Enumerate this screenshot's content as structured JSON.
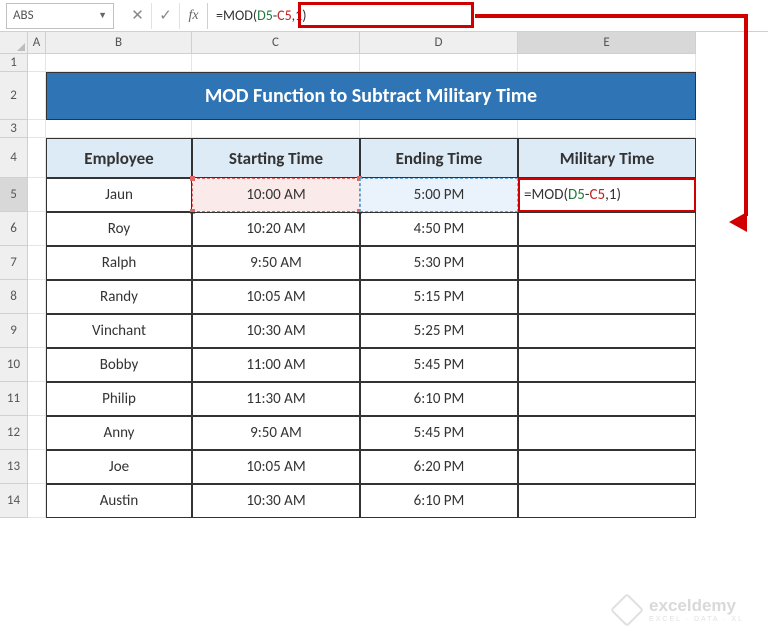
{
  "name_box": "ABS",
  "formula_bar": {
    "fx_label": "fx",
    "formula_raw": "=MOD(D5-C5,1)"
  },
  "columns": [
    "A",
    "B",
    "C",
    "D",
    "E"
  ],
  "row_numbers": [
    "1",
    "2",
    "3",
    "4",
    "5",
    "6",
    "7",
    "8",
    "9",
    "10",
    "11",
    "12",
    "13",
    "14"
  ],
  "title": "MOD Function to Subtract Military Time",
  "headers": {
    "employee": "Employee",
    "start": "Starting Time",
    "end": "Ending Time",
    "mil": "Military Time"
  },
  "editing_formula": "=MOD(D5-C5,1)",
  "rows": [
    {
      "employee": "Jaun",
      "start": "10:00 AM",
      "end": "5:00 PM",
      "mil": ""
    },
    {
      "employee": "Roy",
      "start": "10:20 AM",
      "end": "4:50 PM",
      "mil": ""
    },
    {
      "employee": "Ralph",
      "start": "9:50 AM",
      "end": "5:30 PM",
      "mil": ""
    },
    {
      "employee": "Randy",
      "start": "10:05 AM",
      "end": "5:15 PM",
      "mil": ""
    },
    {
      "employee": "Vinchant",
      "start": "10:30 AM",
      "end": "5:25 PM",
      "mil": ""
    },
    {
      "employee": "Bobby",
      "start": "11:00 AM",
      "end": "5:45 PM",
      "mil": ""
    },
    {
      "employee": "Philip",
      "start": "11:30 AM",
      "end": "6:10 PM",
      "mil": ""
    },
    {
      "employee": "Anny",
      "start": "9:50 AM",
      "end": "5:45 PM",
      "mil": ""
    },
    {
      "employee": "Joe",
      "start": "10:05 AM",
      "end": "6:20 PM",
      "mil": ""
    },
    {
      "employee": "Austin",
      "start": "10:30 AM",
      "end": "6:10 PM",
      "mil": ""
    }
  ],
  "watermark": {
    "brand": "exceldemy",
    "sub": "EXCEL · DATA · XL"
  },
  "chart_data": {
    "type": "table",
    "title": "MOD Function to Subtract Military Time",
    "columns": [
      "Employee",
      "Starting Time",
      "Ending Time",
      "Military Time"
    ],
    "rows": [
      [
        "Jaun",
        "10:00 AM",
        "5:00 PM",
        "=MOD(D5-C5,1)"
      ],
      [
        "Roy",
        "10:20 AM",
        "4:50 PM",
        ""
      ],
      [
        "Ralph",
        "9:50 AM",
        "5:30 PM",
        ""
      ],
      [
        "Randy",
        "10:05 AM",
        "5:15 PM",
        ""
      ],
      [
        "Vinchant",
        "10:30 AM",
        "5:25 PM",
        ""
      ],
      [
        "Bobby",
        "11:00 AM",
        "5:45 PM",
        ""
      ],
      [
        "Philip",
        "11:30 AM",
        "6:10 PM",
        ""
      ],
      [
        "Anny",
        "9:50 AM",
        "5:45 PM",
        ""
      ],
      [
        "Joe",
        "10:05 AM",
        "6:20 PM",
        ""
      ],
      [
        "Austin",
        "10:30 AM",
        "6:10 PM",
        ""
      ]
    ]
  }
}
